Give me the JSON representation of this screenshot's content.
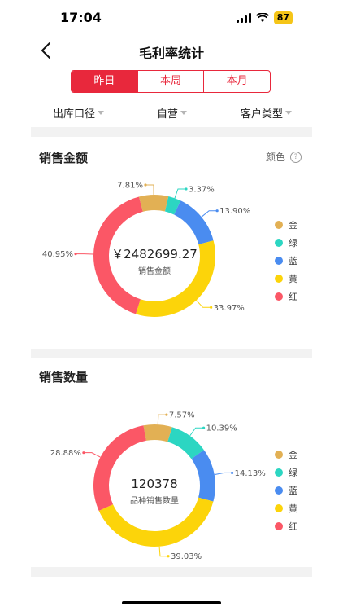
{
  "status_bar": {
    "time": "17:04",
    "battery": "87"
  },
  "nav": {
    "title": "毛利率统计"
  },
  "tabs": [
    {
      "label": "昨日",
      "active": true
    },
    {
      "label": "本周",
      "active": false
    },
    {
      "label": "本月",
      "active": false
    }
  ],
  "filters": [
    "出库口径",
    "自营",
    "客户类型"
  ],
  "sales_amount": {
    "title": "销售金额",
    "color_label": "颜色",
    "help": "?"
  },
  "sales_quantity": {
    "title": "销售数量"
  },
  "colors": {
    "金": "#e2b054",
    "绿": "#2cd6c2",
    "蓝": "#4a8cf0",
    "黄": "#fcd40a",
    "红": "#fb5766",
    "accent": "#e8283c"
  },
  "chart_data": [
    {
      "type": "pie",
      "title": "销售金额",
      "center_value": "￥2482699.27",
      "center_label": "销售金额",
      "legend": [
        "金",
        "绿",
        "蓝",
        "黄",
        "红"
      ],
      "slices": [
        {
          "name": "金",
          "value": 7.81,
          "label": "7.81%"
        },
        {
          "name": "绿",
          "value": 3.37,
          "label": "3.37%"
        },
        {
          "name": "蓝",
          "value": 13.9,
          "label": "13.90%"
        },
        {
          "name": "黄",
          "value": 33.97,
          "label": "33.97%"
        },
        {
          "name": "红",
          "value": 40.95,
          "label": "40.95%"
        }
      ]
    },
    {
      "type": "pie",
      "title": "销售数量",
      "center_value": "120378",
      "center_label": "品种销售数量",
      "legend": [
        "金",
        "绿",
        "蓝",
        "黄",
        "红"
      ],
      "slices": [
        {
          "name": "金",
          "value": 7.57,
          "label": "7.57%"
        },
        {
          "name": "绿",
          "value": 10.39,
          "label": "10.39%"
        },
        {
          "name": "蓝",
          "value": 14.13,
          "label": "14.13%"
        },
        {
          "name": "黄",
          "value": 39.03,
          "label": "39.03%"
        },
        {
          "name": "红",
          "value": 28.88,
          "label": "28.88%"
        }
      ]
    }
  ]
}
